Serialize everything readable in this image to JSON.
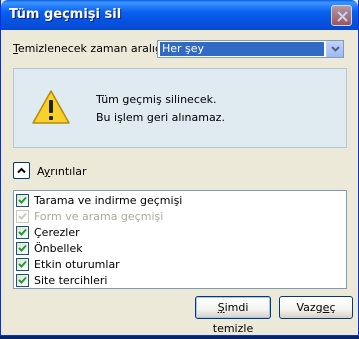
{
  "window": {
    "title": "Tüm geçmişi sil",
    "close_icon": "close-icon"
  },
  "range": {
    "label_mnemonic": "T",
    "label_rest": "emizlenecek zaman aralığı:",
    "selected_value": "Her şey"
  },
  "warning": {
    "icon": "warning-icon",
    "line1": "Tüm geçmiş silinecek.",
    "line2": "Bu işlem geri alınamaz."
  },
  "details": {
    "label_pre": "A",
    "label_mnemonic": "y",
    "label_rest": "rıntılar",
    "expanded": true
  },
  "items": [
    {
      "label": "Tarama ve indirme geçmişi",
      "checked": true,
      "enabled": true
    },
    {
      "label": "Form ve arama geçmişi",
      "checked": true,
      "enabled": false
    },
    {
      "label": "Çerezler",
      "checked": true,
      "enabled": true
    },
    {
      "label": "Önbellek",
      "checked": true,
      "enabled": true
    },
    {
      "label": "Etkin oturumlar",
      "checked": true,
      "enabled": true
    },
    {
      "label": "Site tercihleri",
      "checked": true,
      "enabled": true
    }
  ],
  "buttons": {
    "primary_mnemonic": "Ş",
    "primary_rest": "imdi temizle",
    "secondary_pre": "Vazg",
    "secondary_mnemonic": "e",
    "secondary_rest": "ç"
  },
  "colors": {
    "titlebar": "#0653e0",
    "selection": "#316ac5",
    "warning_bg": "#dfeaf1",
    "check": "#21a121"
  }
}
